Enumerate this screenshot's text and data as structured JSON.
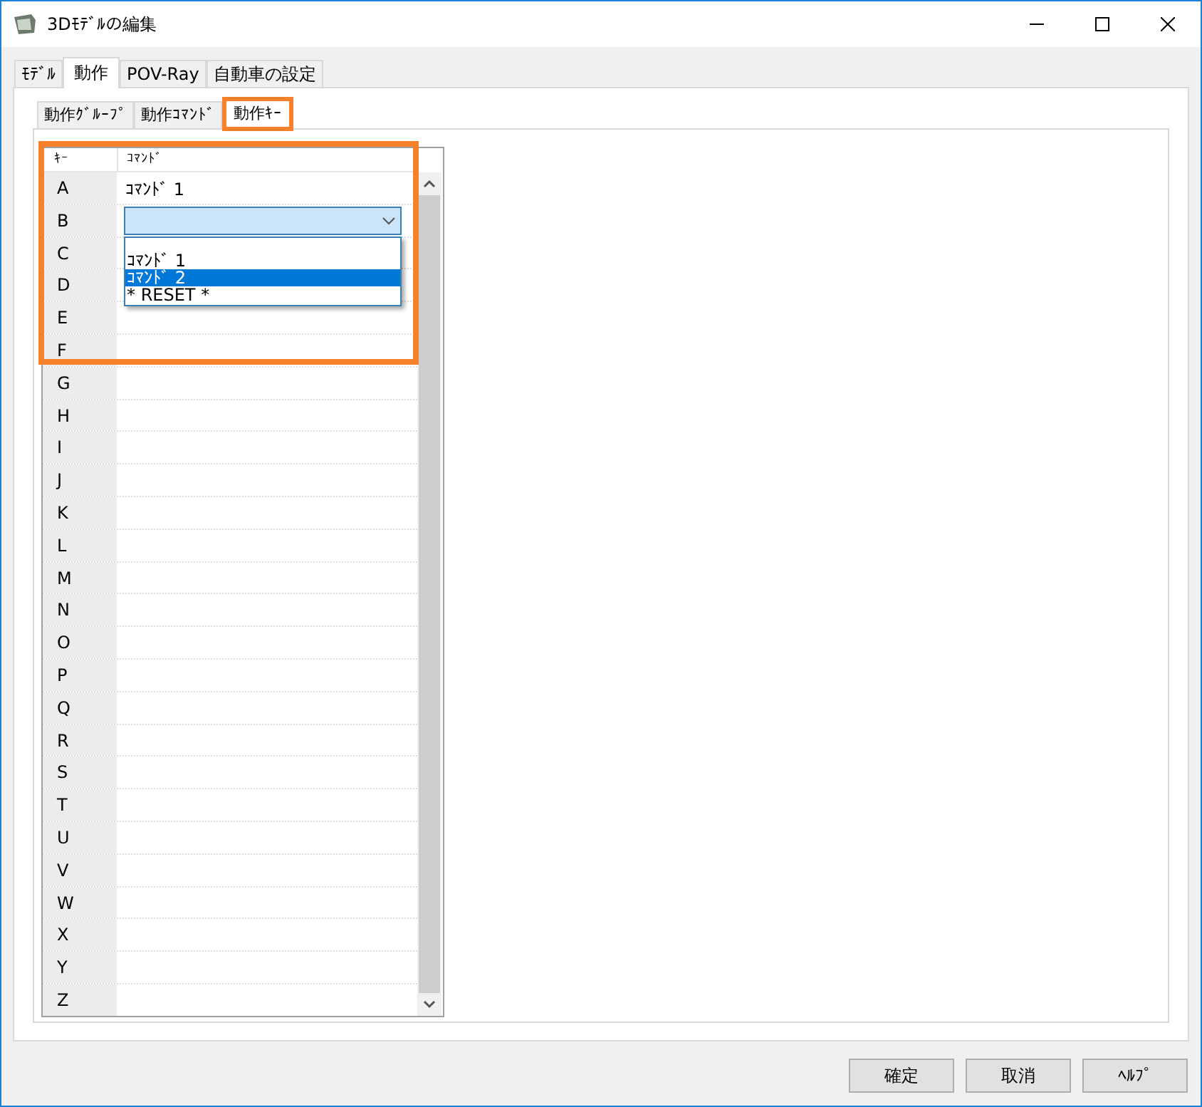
{
  "window": {
    "title": "3Dﾓﾃﾞﾙの編集"
  },
  "tabs": [
    {
      "label": "ﾓﾃﾞﾙ",
      "selected": false
    },
    {
      "label": "動作",
      "selected": true
    },
    {
      "label": "POV-Ray",
      "selected": false
    },
    {
      "label": "自動車の設定",
      "selected": false
    }
  ],
  "subtabs": [
    {
      "label": "動作ｸﾞﾙｰﾌﾟ",
      "selected": false,
      "highlighted": false
    },
    {
      "label": "動作ｺﾏﾝﾄﾞ",
      "selected": false,
      "highlighted": false
    },
    {
      "label": "動作ｷｰ",
      "selected": true,
      "highlighted": true
    }
  ],
  "table": {
    "highlighted": true,
    "columns": [
      "ｷｰ",
      "ｺﾏﾝﾄﾞ"
    ],
    "rows": [
      {
        "key": "A",
        "kind": "text",
        "command": "ｺﾏﾝﾄﾞ 1"
      },
      {
        "key": "B",
        "kind": "dropdown",
        "open": true,
        "options": [
          {
            "label": "ｺﾏﾝﾄﾞ 1",
            "selected": false
          },
          {
            "label": "ｺﾏﾝﾄﾞ 2",
            "selected": true
          },
          {
            "label": "* RESET *",
            "selected": false
          }
        ]
      },
      {
        "key": "C",
        "kind": "text"
      },
      {
        "key": "D",
        "kind": "text"
      },
      {
        "key": "E",
        "kind": "text"
      },
      {
        "key": "F",
        "kind": "text"
      },
      {
        "key": "G",
        "kind": "text"
      },
      {
        "key": "H",
        "kind": "text"
      },
      {
        "key": "I",
        "kind": "text"
      },
      {
        "key": "J",
        "kind": "text"
      },
      {
        "key": "K",
        "kind": "text"
      },
      {
        "key": "L",
        "kind": "text"
      },
      {
        "key": "M",
        "kind": "text"
      },
      {
        "key": "N",
        "kind": "text"
      },
      {
        "key": "O",
        "kind": "text"
      },
      {
        "key": "P",
        "kind": "text"
      },
      {
        "key": "Q",
        "kind": "text"
      },
      {
        "key": "R",
        "kind": "text"
      },
      {
        "key": "S",
        "kind": "text"
      },
      {
        "key": "T",
        "kind": "text"
      },
      {
        "key": "U",
        "kind": "text"
      },
      {
        "key": "V",
        "kind": "text"
      },
      {
        "key": "W",
        "kind": "text"
      },
      {
        "key": "X",
        "kind": "text"
      },
      {
        "key": "Y",
        "kind": "text"
      },
      {
        "key": "Z",
        "kind": "text"
      }
    ]
  },
  "buttons": [
    "確定",
    "取消",
    "ﾍﾙﾌﾟ"
  ]
}
